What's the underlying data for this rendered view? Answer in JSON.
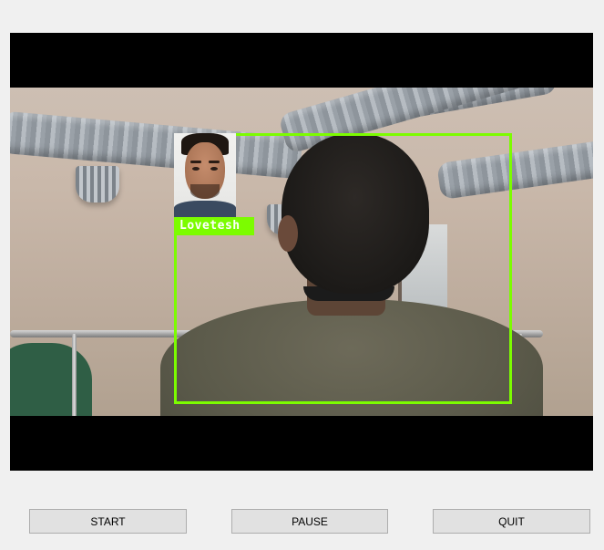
{
  "video": {
    "detected_name": "Lovetesh"
  },
  "controls": {
    "start_label": "START",
    "pause_label": "PAUSE",
    "quit_label": "QUIT"
  },
  "colors": {
    "detection_box": "#7cfc00",
    "label_text": "#ffffff",
    "window_background": "#f0f0f0",
    "button_background": "#e1e1e1"
  }
}
